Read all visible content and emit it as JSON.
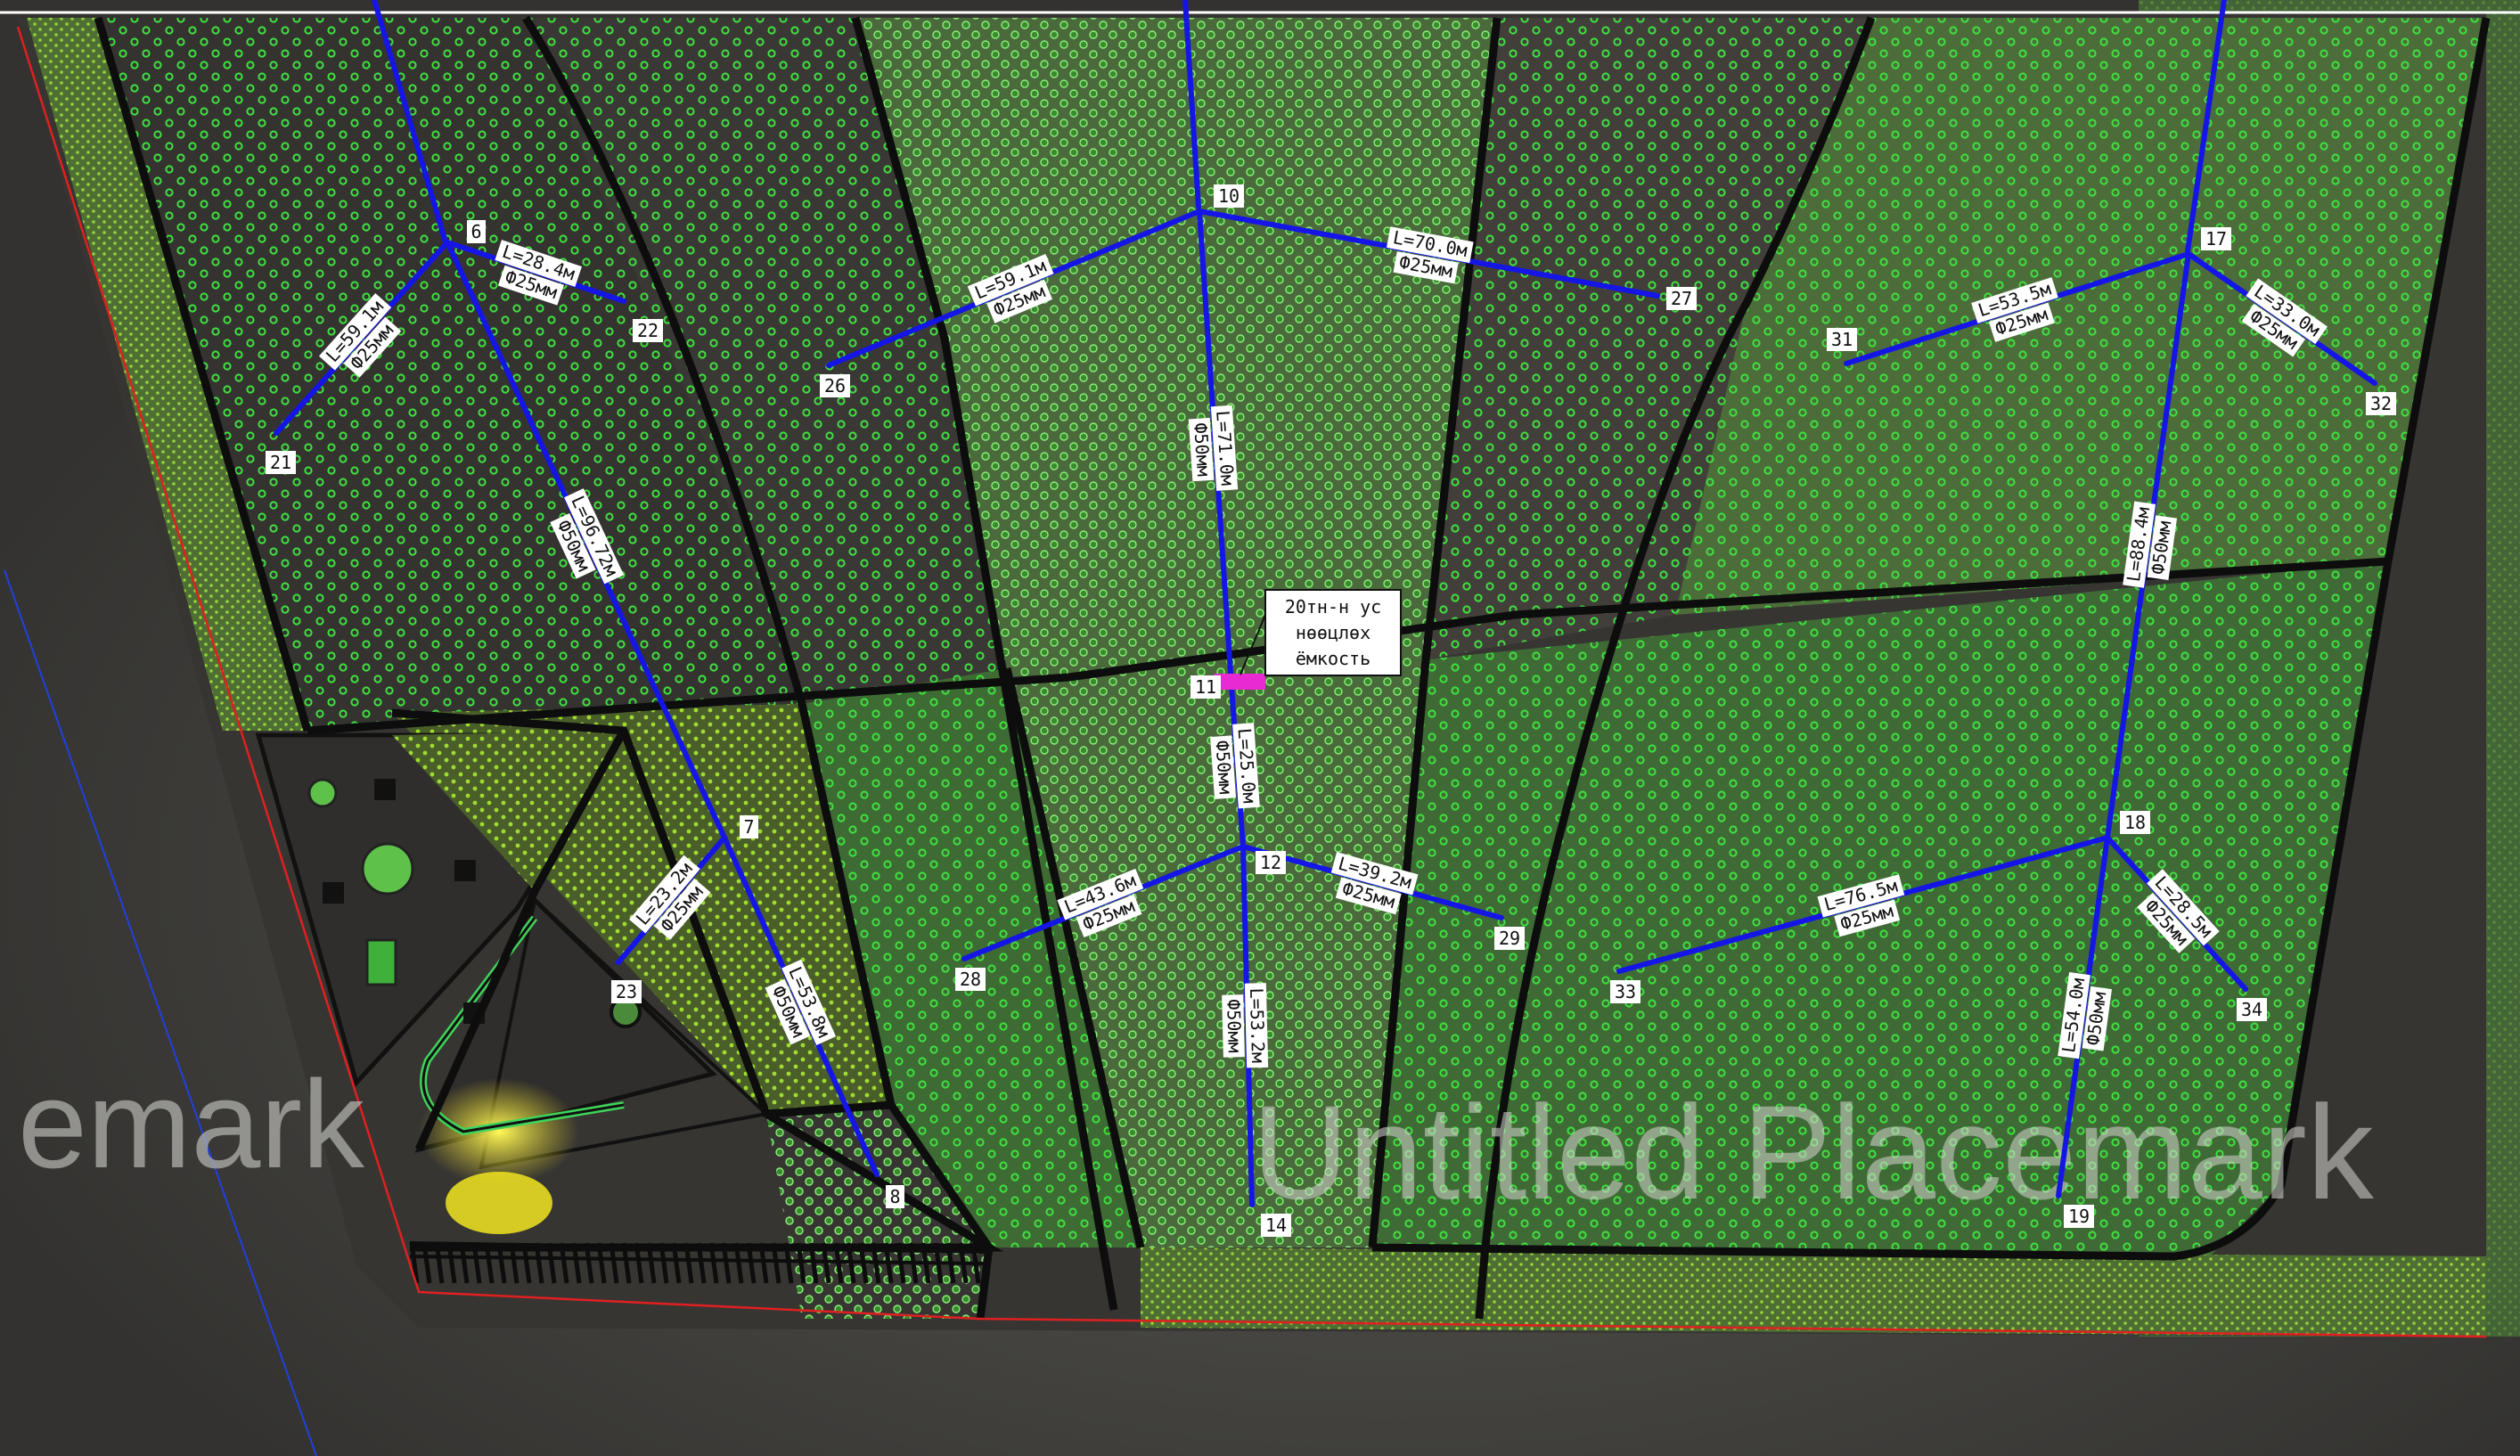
{
  "map": {
    "watermark_left": "emark",
    "watermark_right": "Untitled Placemark",
    "tank_label": [
      "20тн-н ус",
      "нөөцлөх",
      "ёмкость"
    ],
    "nodes": [
      {
        "id": "6",
        "label": "6"
      },
      {
        "id": "7",
        "label": "7"
      },
      {
        "id": "8",
        "label": "8"
      },
      {
        "id": "10",
        "label": "10"
      },
      {
        "id": "11",
        "label": "11"
      },
      {
        "id": "12",
        "label": "12"
      },
      {
        "id": "14",
        "label": "14"
      },
      {
        "id": "17",
        "label": "17"
      },
      {
        "id": "18",
        "label": "18"
      },
      {
        "id": "19",
        "label": "19"
      },
      {
        "id": "21",
        "label": "21"
      },
      {
        "id": "22",
        "label": "22"
      },
      {
        "id": "23",
        "label": "23"
      },
      {
        "id": "26",
        "label": "26"
      },
      {
        "id": "27",
        "label": "27"
      },
      {
        "id": "28",
        "label": "28"
      },
      {
        "id": "29",
        "label": "29"
      },
      {
        "id": "31",
        "label": "31"
      },
      {
        "id": "32",
        "label": "32"
      },
      {
        "id": "33",
        "label": "33"
      },
      {
        "id": "34",
        "label": "34"
      }
    ],
    "pipes": [
      {
        "from": "6",
        "to": "21",
        "length": "L=59.1м",
        "diameter": "Ф25мм"
      },
      {
        "from": "6",
        "to": "22",
        "length": "L=28.4м",
        "diameter": "Ф25мм"
      },
      {
        "from": "6",
        "to": "7",
        "length": "L=96.72м",
        "diameter": "Ф50мм"
      },
      {
        "from": "7",
        "to": "23",
        "length": "L=23.2м",
        "diameter": "Ф25мм"
      },
      {
        "from": "7",
        "to": "8",
        "length": "L=53.8м",
        "diameter": "Ф50мм"
      },
      {
        "from": "10",
        "to": "26",
        "length": "L=59.1м",
        "diameter": "Ф25мм"
      },
      {
        "from": "10",
        "to": "27",
        "length": "L=70.0м",
        "diameter": "Ф25мм"
      },
      {
        "from": "10",
        "to": "11",
        "length": "L=71.0м",
        "diameter": "Ф50мм"
      },
      {
        "from": "11",
        "to": "12",
        "length": "L=25.0м",
        "diameter": "Ф50мм"
      },
      {
        "from": "12",
        "to": "28",
        "length": "L=43.6м",
        "diameter": "Ф25мм"
      },
      {
        "from": "12",
        "to": "29",
        "length": "L=39.2м",
        "diameter": "Ф25мм"
      },
      {
        "from": "12",
        "to": "14",
        "length": "L=53.2м",
        "diameter": "Ф50мм"
      },
      {
        "from": "17",
        "to": "31",
        "length": "L=53.5м",
        "diameter": "Ф25мм"
      },
      {
        "from": "17",
        "to": "32",
        "length": "L=33.0м",
        "diameter": "Ф25мм"
      },
      {
        "from": "17",
        "to": "18",
        "length": "L=88.4м",
        "diameter": "Ф50мм"
      },
      {
        "from": "18",
        "to": "33",
        "length": "L=76.5м",
        "diameter": "Ф25мм"
      },
      {
        "from": "18",
        "to": "34",
        "length": "L=28.5м",
        "diameter": "Ф25мм"
      },
      {
        "from": "18",
        "to": "19",
        "length": "L=54.0м",
        "diameter": "Ф50мм"
      }
    ],
    "colors": {
      "pipe": "#1515e6",
      "tank": "#e82ad2",
      "tree": "#3fe03f",
      "boundary": "#e02020",
      "path": "#0d0d0d",
      "field": "#4e6e3a",
      "ground": "#45443f"
    }
  }
}
